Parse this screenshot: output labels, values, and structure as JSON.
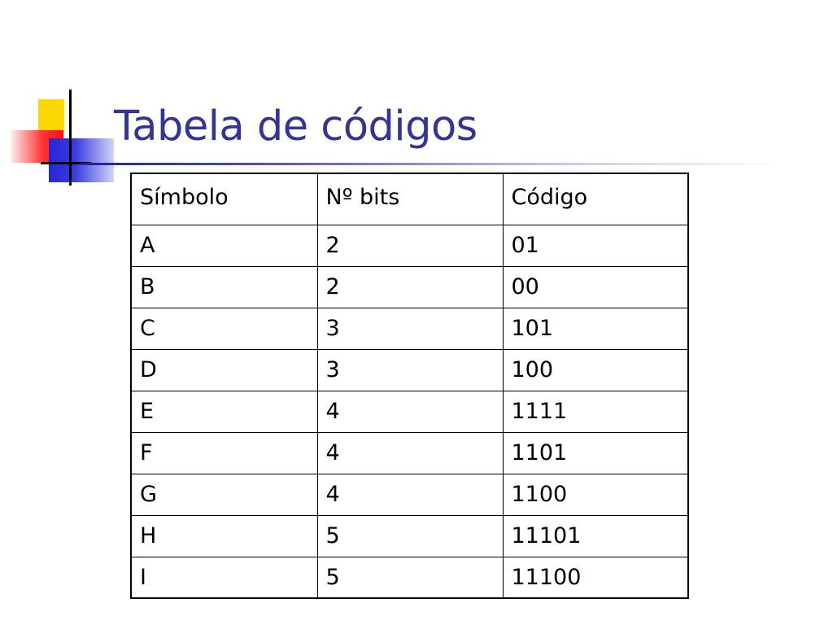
{
  "slide": {
    "title": "Tabela de códigos"
  },
  "table": {
    "headers": [
      "Símbolo",
      "Nº bits",
      "Código"
    ],
    "rows": [
      [
        "A",
        "2",
        "01"
      ],
      [
        "B",
        "2",
        "00"
      ],
      [
        "C",
        "3",
        "101"
      ],
      [
        "D",
        "3",
        "100"
      ],
      [
        "E",
        "4",
        "1111"
      ],
      [
        "F",
        "4",
        "1101"
      ],
      [
        "G",
        "4",
        "1100"
      ],
      [
        "H",
        "5",
        "11101"
      ],
      [
        "I",
        "5",
        "11100"
      ]
    ]
  },
  "colors": {
    "title": "#333399",
    "accent_yellow": "#ffd700",
    "accent_red": "#ff2a2a",
    "accent_blue": "#2727d8",
    "rule": "#1f1fa0",
    "table_border": "#000000"
  }
}
